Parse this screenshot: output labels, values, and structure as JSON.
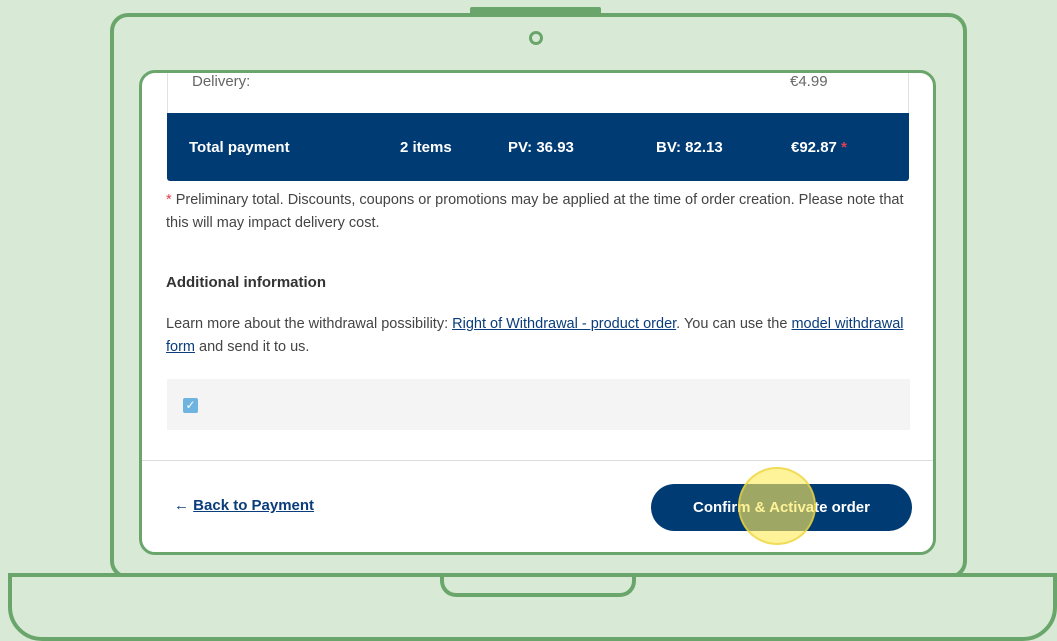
{
  "summary": {
    "delivery_label": "Delivery:",
    "delivery_value": "€4.99"
  },
  "total": {
    "label": "Total payment",
    "items": "2 items",
    "pv": "PV: 36.93",
    "bv": "BV: 82.13",
    "amount": "€92.87",
    "asterisk": "*"
  },
  "note": {
    "asterisk": "*",
    "text": "Preliminary total. Discounts, coupons or promotions may be applied at the time of order creation. Please note that this will may impact delivery cost."
  },
  "additional": {
    "title": "Additional information",
    "text_before": "Learn more about the withdrawal possibility: ",
    "link1": "Right of Withdrawal - product order",
    "text_middle": ". You can use the ",
    "link2": "model withdrawal form",
    "text_after": " and send it to us."
  },
  "consent": {
    "checked": true,
    "check_glyph": "✓"
  },
  "footer": {
    "back_arrow": "←",
    "back_label": "Back to Payment",
    "confirm_label": "Confirm & Activate order"
  },
  "colors": {
    "primary": "#003b73",
    "accent_red": "#e04050",
    "frame_green": "#6aa66b",
    "background": "#d8ead5",
    "highlight": "#ffec5a"
  }
}
